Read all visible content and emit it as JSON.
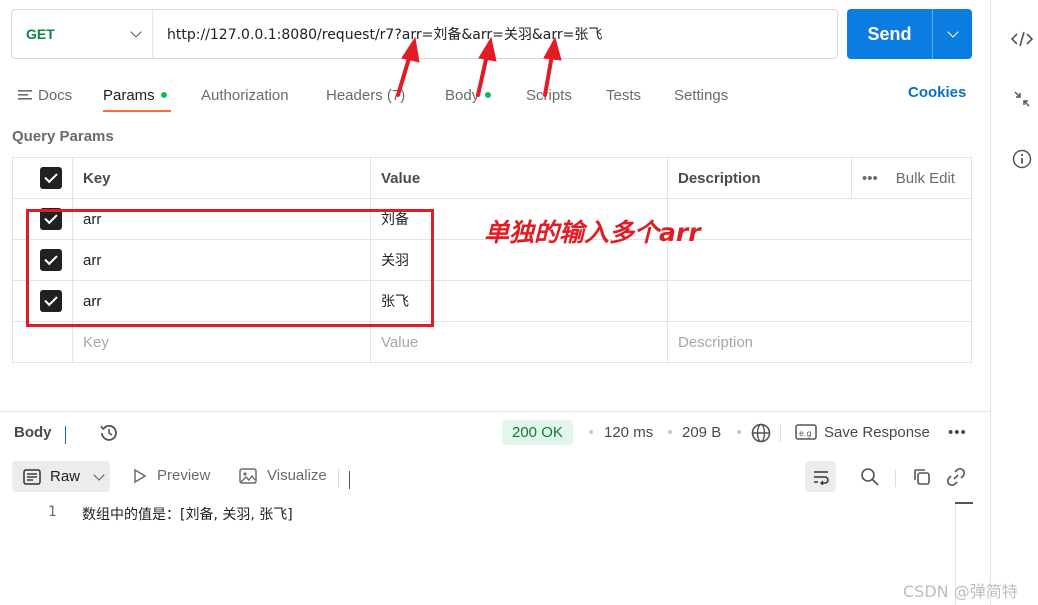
{
  "request": {
    "method": "GET",
    "url": "http://127.0.0.1:8080/request/r7?arr=刘备&arr=关羽&arr=张飞",
    "send_label": "Send"
  },
  "tabs": [
    {
      "label": "Docs"
    },
    {
      "label": "Params",
      "active": true
    },
    {
      "label": "Authorization"
    },
    {
      "label": "Headers (7)"
    },
    {
      "label": "Body"
    },
    {
      "label": "Scripts"
    },
    {
      "label": "Tests"
    },
    {
      "label": "Settings"
    }
  ],
  "cookies_label": "Cookies",
  "query_params": {
    "title": "Query Params",
    "columns": {
      "key": "Key",
      "value": "Value",
      "description": "Description",
      "bulk_edit": "Bulk Edit"
    },
    "rows": [
      {
        "key": "arr",
        "value": "刘备",
        "checked": true
      },
      {
        "key": "arr",
        "value": "关羽",
        "checked": true
      },
      {
        "key": "arr",
        "value": "张飞",
        "checked": true
      }
    ],
    "placeholders": {
      "key": "Key",
      "value": "Value",
      "description": "Description"
    }
  },
  "annotation": "单独的输入多个arr",
  "response": {
    "body_label": "Body",
    "status": "200 OK",
    "time": "120 ms",
    "size": "209 B",
    "save_label": "Save Response",
    "format": "Raw",
    "preview_label": "Preview",
    "visualize_label": "Visualize",
    "lines": [
      {
        "no": "1",
        "text": "数组中的值是：[刘备, 关羽, 张飞]"
      }
    ]
  },
  "watermark": "CSDN @弹简特",
  "colors": {
    "accent": "#0b7de0",
    "method": "#0b8a3b",
    "annotation": "#e11c24",
    "tab_underline": "#ff6c37",
    "status_bg": "#e3f6ea"
  }
}
